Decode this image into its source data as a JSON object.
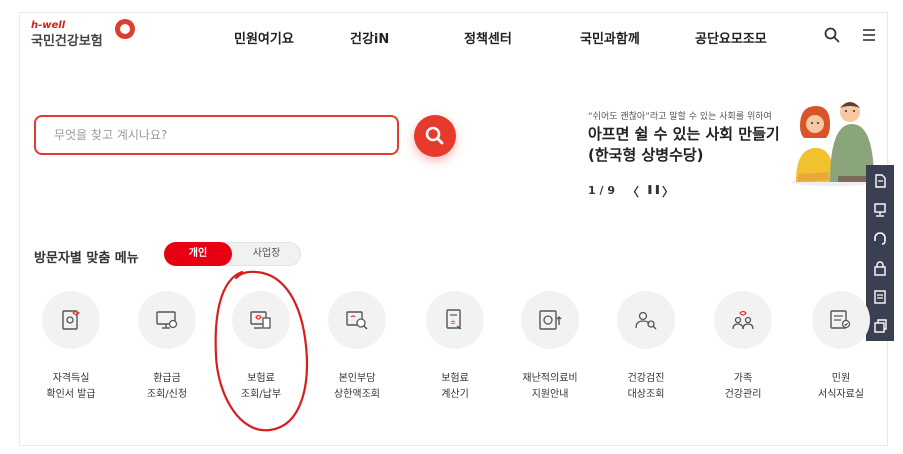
{
  "logo": {
    "brand": "h-well",
    "name": "국민건강보험"
  },
  "nav": [
    {
      "label": "민원여기요"
    },
    {
      "label": "건강iN"
    },
    {
      "label": "정책센터"
    },
    {
      "label": "국민과함께"
    },
    {
      "label": "공단요모조모"
    }
  ],
  "header_icons": [
    "search-icon",
    "hamburger-menu-icon"
  ],
  "search": {
    "placeholder": "무엇을 찾고 계시나요?",
    "button_icon": "search-icon"
  },
  "banner": {
    "subtitle": "“쉬어도 괜찮아”라고 말할 수 있는 사회를 위하여",
    "title_line1": "아프면 쉴 수 있는 사회 만들기",
    "title_line2": "(한국형 상병수당)",
    "page": "1 / 9",
    "prev": "〈",
    "pause": "❚❚",
    "next": "〉"
  },
  "side_toolbar": [
    "document-icon",
    "monitor-icon",
    "headset-icon",
    "lock-icon",
    "form-icon",
    "copy-icon"
  ],
  "visitor_menu": {
    "title": "방문자별 맞춤 메뉴",
    "toggle": {
      "active": "개인",
      "inactive": "사업장"
    },
    "items": [
      {
        "line1": "자격득실",
        "line2": "확인서 발급",
        "icon": "certificate-icon"
      },
      {
        "line1": "환급금",
        "line2": "조회/신청",
        "icon": "monitor-refund-icon"
      },
      {
        "line1": "보험료",
        "line2": "조회/납부",
        "icon": "premium-payment-icon"
      },
      {
        "line1": "본인부담",
        "line2": "상한액조회",
        "icon": "document-search-icon"
      },
      {
        "line1": "보험료",
        "line2": "계산기",
        "icon": "calculator-icon"
      },
      {
        "line1": "재난적의료비",
        "line2": "지원안내",
        "icon": "medical-cost-icon"
      },
      {
        "line1": "건강검진",
        "line2": "대상조회",
        "icon": "people-search-icon"
      },
      {
        "line1": "가족",
        "line2": "건강관리",
        "icon": "family-icon"
      },
      {
        "line1": "민원",
        "line2": "서식자료실",
        "icon": "form-library-icon"
      }
    ]
  },
  "colors": {
    "brand_red": "#e03c31",
    "toggle_red": "#e60012",
    "sidebar": "#3a3f52",
    "annotation": "#d81e1e"
  }
}
